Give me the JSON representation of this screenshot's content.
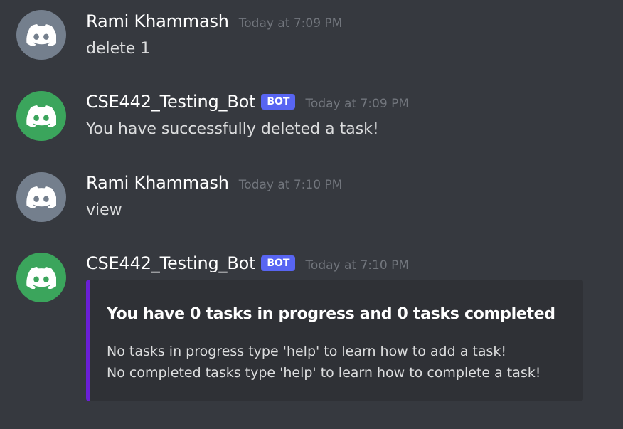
{
  "colors": {
    "background": "#36393f",
    "user_avatar": "#747f8d",
    "bot_avatar": "#3ba55c",
    "bot_tag": "#5865f2",
    "embed_accent": "#6a1fd6",
    "embed_background": "#2f3136"
  },
  "messages": [
    {
      "author": "Rami Khammash",
      "timestamp": "Today at 7:09 PM",
      "text": "delete 1",
      "avatar_icon": "discord-logo-icon"
    },
    {
      "author": "CSE442_Testing_Bot",
      "tag": "BOT",
      "timestamp": "Today at 7:09 PM",
      "text": "You have successfully deleted a task!",
      "avatar_icon": "discord-logo-icon"
    },
    {
      "author": "Rami Khammash",
      "timestamp": "Today at 7:10 PM",
      "text": "view",
      "avatar_icon": "discord-logo-icon"
    },
    {
      "author": "CSE442_Testing_Bot",
      "tag": "BOT",
      "timestamp": "Today at 7:10 PM",
      "avatar_icon": "discord-logo-icon",
      "embed": {
        "title": "You have 0 tasks in progress and 0 tasks completed",
        "lines": [
          "No tasks in progress type 'help' to learn how to add a task!",
          "No completed tasks type 'help' to learn how to complete a task!"
        ]
      }
    }
  ]
}
